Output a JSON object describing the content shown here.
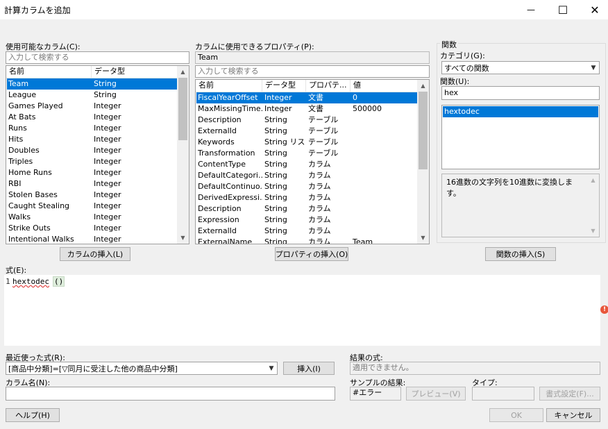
{
  "window": {
    "title": "計算カラムを追加",
    "minimize": "—",
    "maximize": "☐",
    "close": "✕"
  },
  "columns_panel": {
    "label": "使用可能なカラム(C):",
    "search_placeholder": "入力して検索する",
    "headers": [
      "名前",
      "データ型"
    ],
    "rows": [
      [
        "Team",
        "String"
      ],
      [
        "League",
        "String"
      ],
      [
        "Games Played",
        "Integer"
      ],
      [
        "At Bats",
        "Integer"
      ],
      [
        "Runs",
        "Integer"
      ],
      [
        "Hits",
        "Integer"
      ],
      [
        "Doubles",
        "Integer"
      ],
      [
        "Triples",
        "Integer"
      ],
      [
        "Home Runs",
        "Integer"
      ],
      [
        "RBI",
        "Integer"
      ],
      [
        "Stolen Bases",
        "Integer"
      ],
      [
        "Caught Stealing",
        "Integer"
      ],
      [
        "Walks",
        "Integer"
      ],
      [
        "Strike Outs",
        "Integer"
      ],
      [
        "Intentional Walks",
        "Integer"
      ]
    ],
    "insert_button": "カラムの挿入(L)"
  },
  "properties_panel": {
    "label": "カラムに使用できるプロパティ(P):",
    "context_value": "Team",
    "search_placeholder": "入力して検索する",
    "headers": [
      "名前",
      "データ型",
      "プロパテ...",
      "値"
    ],
    "rows": [
      [
        "FiscalYearOffset",
        "Integer",
        "文書",
        "0"
      ],
      [
        "MaxMissingTime...",
        "Integer",
        "文書",
        "500000"
      ],
      [
        "Description",
        "String",
        "テーブル",
        ""
      ],
      [
        "ExternalId",
        "String",
        "テーブル",
        ""
      ],
      [
        "Keywords",
        "String リスト",
        "テーブル",
        ""
      ],
      [
        "Transformation",
        "String",
        "テーブル",
        ""
      ],
      [
        "ContentType",
        "String",
        "カラム",
        ""
      ],
      [
        "DefaultCategori...",
        "String",
        "カラム",
        ""
      ],
      [
        "DefaultContinuo...",
        "String",
        "カラム",
        ""
      ],
      [
        "DerivedExpressi...",
        "String",
        "カラム",
        ""
      ],
      [
        "Description",
        "String",
        "カラム",
        ""
      ],
      [
        "Expression",
        "String",
        "カラム",
        ""
      ],
      [
        "ExternalId",
        "String",
        "カラム",
        ""
      ],
      [
        "ExternalName",
        "String",
        "カラム",
        "Team"
      ]
    ],
    "insert_button": "プロパティの挿入(O)"
  },
  "functions_panel": {
    "group_label": "関数",
    "category_label": "カテゴリ(G):",
    "category_value": "すべての関数",
    "function_label": "関数(U):",
    "function_search": "hex",
    "functions": [
      "hextodec"
    ],
    "description": "16進数の文字列を10進数に変換します。",
    "insert_button": "関数の挿入(S)"
  },
  "expression": {
    "label": "式(E):",
    "line_number": "1",
    "func_name": "hextodec",
    "parens": "()",
    "error_icon": "!"
  },
  "recent": {
    "label": "最近使った式(R):",
    "value": "[商品中分類]=[▽同月に受注した他の商品中分類]",
    "insert_button": "挿入(I)"
  },
  "column_name": {
    "label": "カラム名(N):",
    "value": ""
  },
  "result": {
    "label": "結果の式:",
    "value": "適用できません。",
    "sample_label": "サンプルの結果:",
    "sample_value": "#エラー",
    "preview_button": "プレビュー(V)",
    "type_label": "タイプ:",
    "type_value": "",
    "format_button": "書式設定(F)..."
  },
  "footer": {
    "help": "ヘルプ(H)",
    "ok": "OK",
    "cancel": "キャンセル"
  },
  "colors": {
    "selection": "#0078d7",
    "error_icon": "#e8563b",
    "window_bg": "#f0f0f0"
  }
}
